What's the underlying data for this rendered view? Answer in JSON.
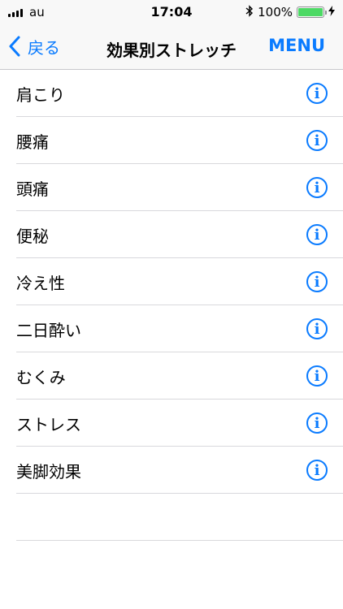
{
  "status_bar": {
    "carrier": "au",
    "time": "17:04",
    "battery_percent": "100%",
    "battery_level": 1.0
  },
  "nav": {
    "back_label": "戻る",
    "title": "効果別ストレッチ",
    "menu_label": "MENU"
  },
  "list": {
    "items": [
      {
        "label": "肩こり"
      },
      {
        "label": "腰痛"
      },
      {
        "label": "頭痛"
      },
      {
        "label": "便秘"
      },
      {
        "label": "冷え性"
      },
      {
        "label": "二日酔い"
      },
      {
        "label": "むくみ"
      },
      {
        "label": "ストレス"
      },
      {
        "label": "美脚効果"
      }
    ],
    "info_glyph": "i"
  },
  "colors": {
    "accent": "#0a7bff",
    "battery": "#4cd964"
  }
}
